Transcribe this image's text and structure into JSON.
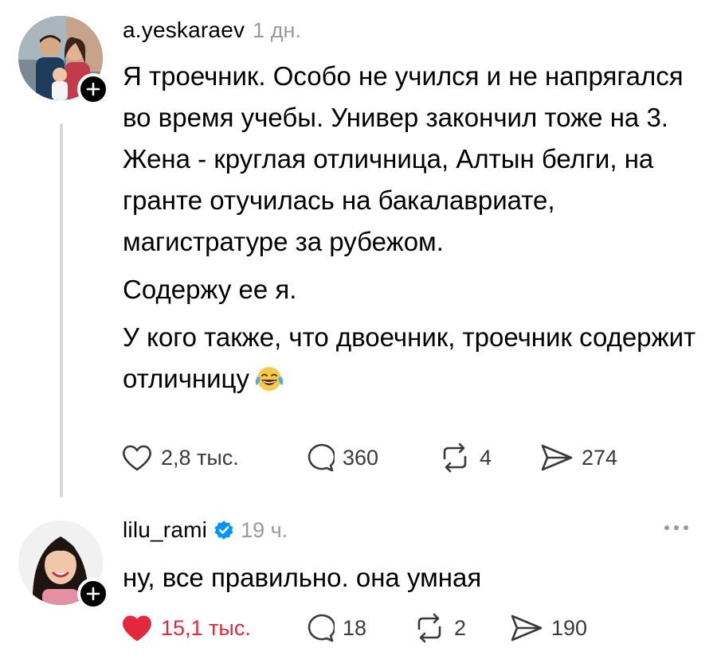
{
  "posts": [
    {
      "username": "a.yeskaraev",
      "time": "1 дн.",
      "paragraphs": [
        "Я троечник. Особо не учился и не напрягался во время учебы. Универ закончил тоже на 3. Жена - круглая отличница, Алтын белги, на гранте отучилась на бакалавриате, магистратуре за рубежом.",
        "Содержу ее я.",
        "У кого также, что двоечник, троечник содержит отличницу"
      ],
      "emoji": "tears-of-joy-emoji",
      "likes": "2,8 тыс.",
      "comments": "360",
      "reposts": "4",
      "shares": "274",
      "liked": false
    },
    {
      "username": "lilu_rami",
      "verified": true,
      "time": "19 ч.",
      "paragraphs": [
        "ну, все правильно. она умная"
      ],
      "likes": "15,1 тыс.",
      "comments": "18",
      "reposts": "2",
      "shares": "190",
      "liked": true
    }
  ],
  "colors": {
    "liked": "#e1283c",
    "verified": "#0095f6",
    "muted": "#9a9a9a",
    "thread_line": "#d9d9d9"
  },
  "icons": {
    "like": "heart-icon",
    "comment": "speech-bubble-icon",
    "repost": "repost-arrows-icon",
    "share": "paper-plane-icon",
    "follow": "plus-icon",
    "more": "more-dots-icon"
  }
}
